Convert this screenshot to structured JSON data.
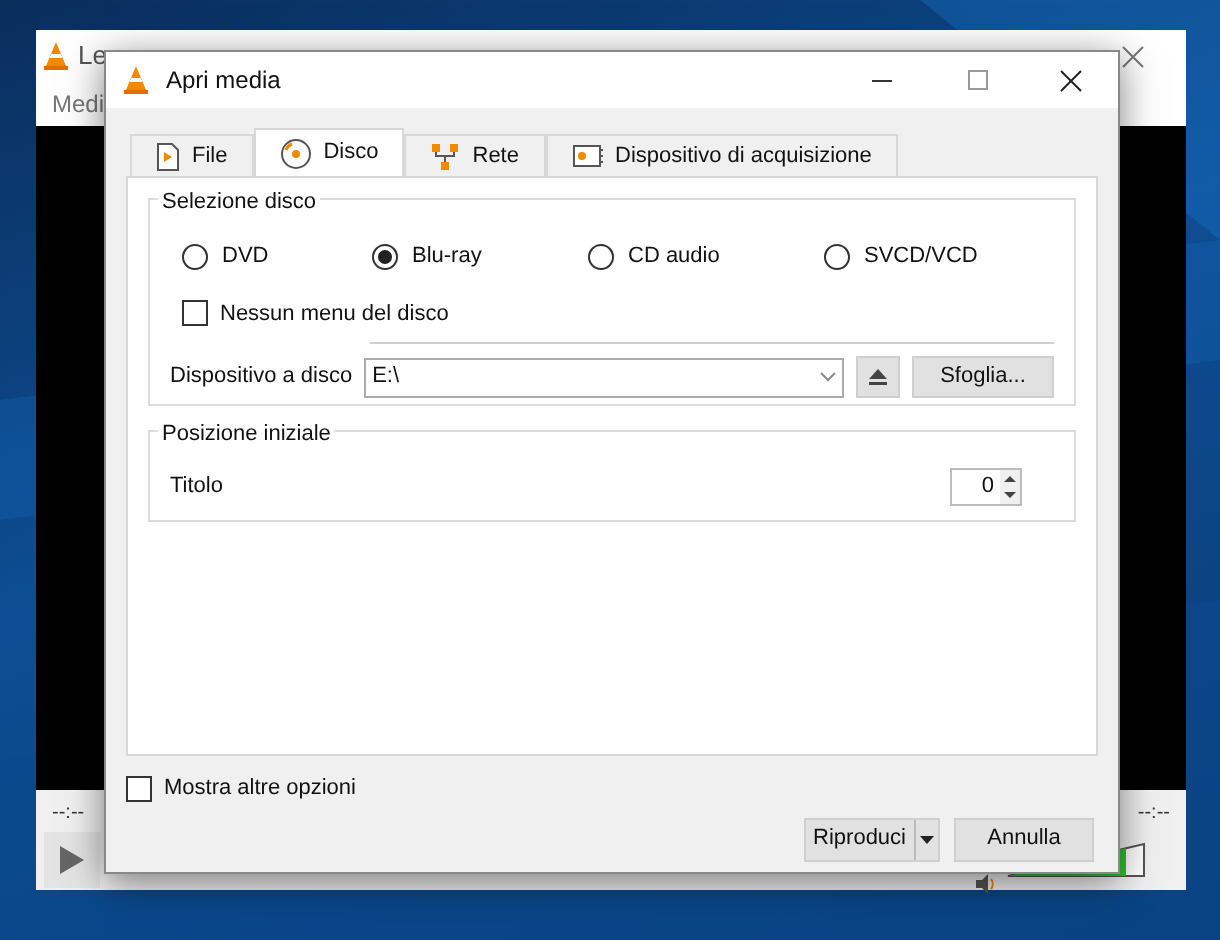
{
  "background_window": {
    "title": "Le",
    "menu": [
      "Medi"
    ],
    "time_elapsed": "--:--",
    "time_total": "--:--",
    "volume": {
      "level": 0.85
    }
  },
  "dialog": {
    "title": "Apri media",
    "tabs": [
      {
        "label": "File",
        "selected": false
      },
      {
        "label": "Disco",
        "selected": true
      },
      {
        "label": "Rete",
        "selected": false
      },
      {
        "label": "Dispositivo di acquisizione",
        "selected": false
      }
    ],
    "disc_selection": {
      "title": "Selezione disco",
      "options": [
        {
          "label": "DVD",
          "selected": false
        },
        {
          "label": "Blu-ray",
          "selected": true
        },
        {
          "label": "CD audio",
          "selected": false
        },
        {
          "label": "SVCD/VCD",
          "selected": false
        }
      ],
      "no_disc_menu": {
        "label": "Nessun menu del disco",
        "checked": false
      },
      "device": {
        "label": "Dispositivo a disco",
        "value": "E:\\"
      },
      "browse_button": "Sfoglia..."
    },
    "start_position": {
      "title": "Posizione iniziale",
      "field_label": "Titolo",
      "value": "0"
    },
    "show_more_options": {
      "label": "Mostra altre opzioni",
      "checked": false
    },
    "buttons": {
      "play": "Riproduci",
      "cancel": "Annulla"
    }
  }
}
